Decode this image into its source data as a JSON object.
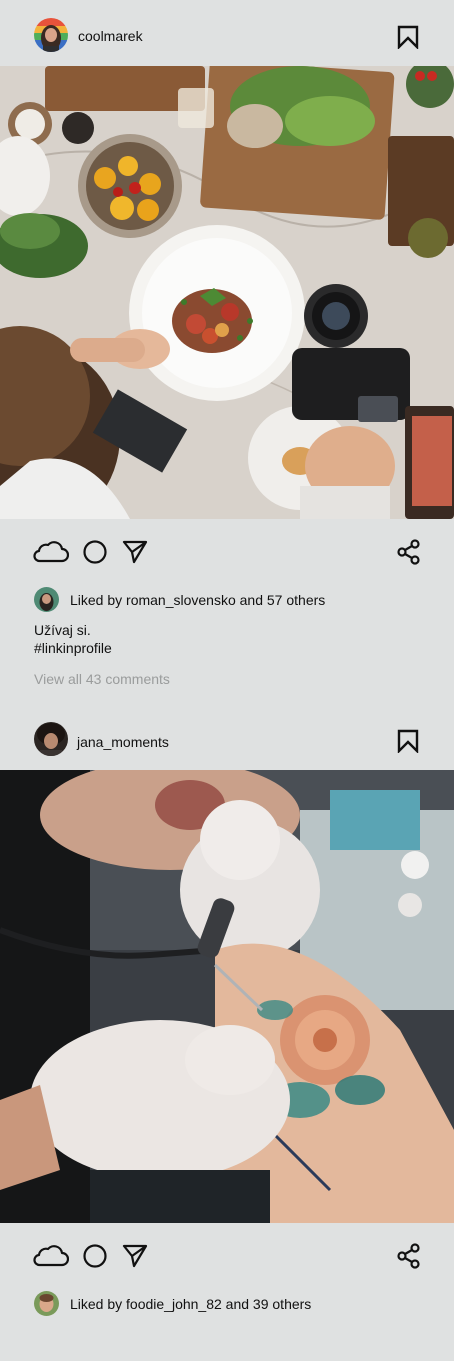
{
  "posts": [
    {
      "username": "coolmarek",
      "likes_text": "Liked by roman_slovensko and 57 others",
      "caption_line1": "Užívaj si.",
      "caption_line2": "#linkinprofile",
      "view_comments": "View all 43 comments"
    },
    {
      "username": "jana_moments",
      "likes_text": "Liked by foodie_john_82 and 39 others"
    }
  ],
  "icons": {
    "like": "cloud-icon",
    "comment": "circle-icon",
    "send": "send-icon",
    "share": "share-icon",
    "save": "bookmark-icon"
  },
  "colors": {
    "background": "#dfe1e1",
    "text": "#111111",
    "muted": "#9a9c9c"
  }
}
